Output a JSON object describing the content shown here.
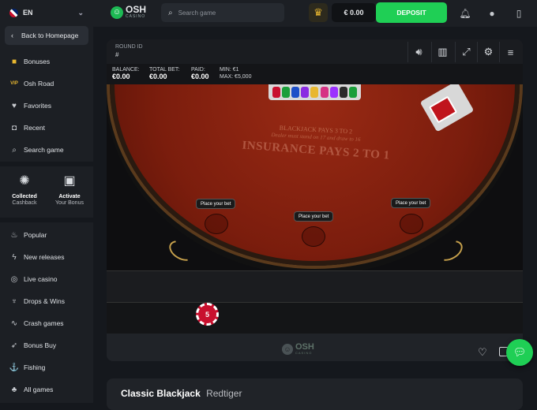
{
  "sidebar": {
    "language": "EN",
    "back_label": "Back to Homepage",
    "top_items": [
      {
        "label": "Bonuses",
        "icon": "gift-icon"
      },
      {
        "label": "Osh Road",
        "icon": "vip-icon"
      },
      {
        "label": "Favorites",
        "icon": "heart-icon"
      },
      {
        "label": "Recent",
        "icon": "history-icon"
      },
      {
        "label": "Search game",
        "icon": "search-icon"
      }
    ],
    "promos": [
      {
        "title": "Collected",
        "subtitle": "Cashback",
        "icon": "cashback-icon"
      },
      {
        "title": "Activate",
        "subtitle": "Your Bonus",
        "icon": "gift-box-icon"
      }
    ],
    "bottom_items": [
      {
        "label": "Popular",
        "icon": "flame-icon"
      },
      {
        "label": "New releases",
        "icon": "lightning-icon"
      },
      {
        "label": "Live casino",
        "icon": "chip-icon"
      },
      {
        "label": "Drops & Wins",
        "icon": "drops-icon"
      },
      {
        "label": "Crash games",
        "icon": "chart-icon"
      },
      {
        "label": "Bonus Buy",
        "icon": "rocket-icon"
      },
      {
        "label": "Fishing",
        "icon": "fishing-icon"
      },
      {
        "label": "All games",
        "icon": "clubs-icon"
      }
    ]
  },
  "header": {
    "logo_name": "OSH",
    "logo_sub": "CASINO",
    "search_placeholder": "Search game",
    "balance": "€ 0.00",
    "deposit_label": "DEPOSIT"
  },
  "game": {
    "round_id_label": "ROUND ID",
    "round_id_value": "#",
    "stats": [
      {
        "label": "BALANCE:",
        "value": "€0.00"
      },
      {
        "label": "TOTAL BET:",
        "value": "€0.00"
      },
      {
        "label": "PAID:",
        "value": "€0.00"
      }
    ],
    "min_label": "MIN: €1",
    "max_label": "MAX: €5,000",
    "felt_line1": "BLACKJACK PAYS 3 TO 2",
    "felt_line2": "Dealer must stand on 17 and draw to 16",
    "felt_line3": "INSURANCE PAYS 2 TO 1",
    "bet_prompt": "Place your bet",
    "chip_value": "5",
    "footer_logo_name": "OSH",
    "footer_logo_sub": "CASINO"
  },
  "title": {
    "game_name": "Classic Blackjack",
    "provider": "Redtiger"
  },
  "colors": {
    "accent_green": "#1fcf55",
    "gold": "#e8b730",
    "felt_red": "#7b1d0d"
  }
}
